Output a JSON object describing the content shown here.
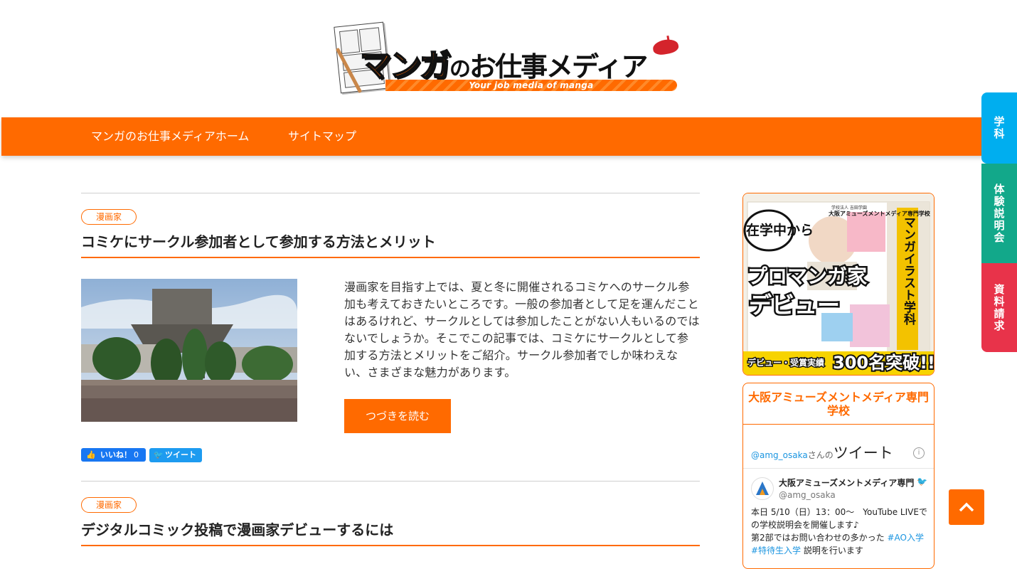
{
  "logo": {
    "title_part1": "マンガ",
    "title_part2": "の",
    "title_part3": "お仕事メディア",
    "tagline": "Your job media of manga"
  },
  "nav": {
    "items": [
      "マンガのお仕事メディアホーム",
      "サイトマップ"
    ]
  },
  "side_tabs": [
    "学科",
    "体験説明会",
    "資料請求"
  ],
  "articles": [
    {
      "category": "漫画家",
      "title": "コミケにサークル参加者として参加する方法とメリット",
      "excerpt": "漫画家を目指す上では、夏と冬に開催されるコミケへのサークル参加も考えておきたいところです。一般の参加者として足を運んだことはあるけれど、サークルとしては参加したことがない人もいるのではないでしょうか。そこでこの記事では、コミケにサークルとして参加する方法とメリットをご紹介。サークル参加者でしか味わえない、さまざまな魅力があります。",
      "read_more": "つづきを読む",
      "fb_label": "いいね！",
      "fb_count": "0",
      "tweet_label": "ツイート"
    },
    {
      "category": "漫画家",
      "title": "デジタルコミック投稿で漫画家デビューするには"
    }
  ],
  "banner": {
    "school_line": "学校法人 吉田学園",
    "school_name": "大阪アミューズメントメディア専門学校",
    "bubble": "在学中から",
    "headline1": "プロマンガ家",
    "headline2": "デビュー",
    "vertical": "マンガイラスト学科",
    "footer_label": "デビュー・受賞実績",
    "footer_count": "300名突破!!"
  },
  "twitter_widget": {
    "title": "大阪アミューズメントメディア専門学校",
    "handle": "@amg_osaka",
    "san": "さんの",
    "word": "ツイート",
    "info": "i",
    "tweet": {
      "display_name": "大阪アミューズメントメディア専門",
      "username": "@amg_osaka",
      "line1": "本日 5/10（日）13：00〜　YouTube LIVEでの学校説明会を開催します♪",
      "line2": "第2部ではお問い合わせの多かった",
      "hashtag1": "#AO入学",
      "hashtag2": "#特待生入学",
      "line3": "説明を行います"
    }
  },
  "colors": {
    "accent": "#ff6a00",
    "tab_blue": "#00aeef",
    "tab_green": "#12a88a",
    "tab_red": "#e8334a",
    "facebook": "#1877f2",
    "twitter": "#1d9bf0"
  },
  "icons": {
    "page_top": "chevron-up-icon",
    "info": "info-icon",
    "twitter": "twitter-bird-icon",
    "facebook_like": "thumbs-up-icon"
  }
}
